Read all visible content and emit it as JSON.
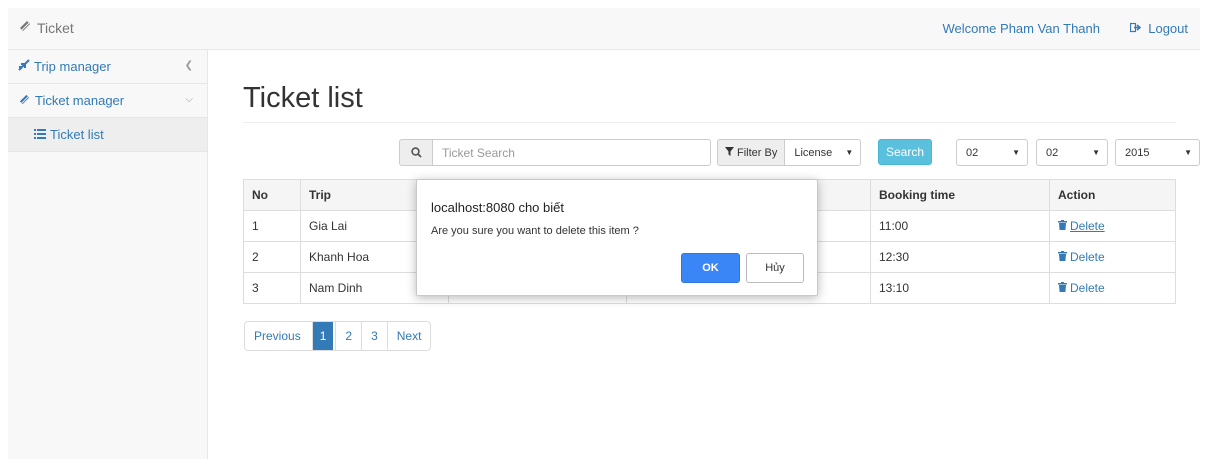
{
  "navbar": {
    "brand": "Ticket",
    "welcome": "Welcome Pham Van Thanh",
    "logout": "Logout"
  },
  "sidebar": {
    "items": [
      {
        "label": "Trip manager",
        "icon": "plane-icon"
      },
      {
        "label": "Ticket manager",
        "icon": "ticket-icon"
      }
    ],
    "sub_items": [
      {
        "label": "Ticket list",
        "icon": "list-icon"
      }
    ]
  },
  "main": {
    "title": "Ticket list"
  },
  "toolbar": {
    "search_placeholder": "Ticket Search",
    "filter_label": "Filter By",
    "filter_value": "License",
    "search_button": "Search",
    "day": "02",
    "month": "02",
    "year": "2015"
  },
  "table": {
    "headers": [
      "No",
      "Trip",
      "",
      "",
      "Booking time",
      "Action"
    ],
    "rows": [
      {
        "no": "1",
        "trip": "Gia Lai",
        "c3": "",
        "c4": "",
        "booking": "11:00",
        "action": "Delete"
      },
      {
        "no": "2",
        "trip": "Khanh Hoa",
        "c3": "",
        "c4": "",
        "booking": "12:30",
        "action": "Delete"
      },
      {
        "no": "3",
        "trip": "Nam Dinh",
        "c3": "",
        "c4": "",
        "booking": "13:10",
        "action": "Delete"
      }
    ]
  },
  "pagination": {
    "previous": "Previous",
    "pages": [
      "1",
      "2",
      "3"
    ],
    "active": "1",
    "next": "Next"
  },
  "dialog": {
    "title": "localhost:8080 cho biết",
    "message": "Are you sure you want to delete this item ?",
    "ok": "OK",
    "cancel": "Hủy"
  },
  "colors": {
    "link": "#337ab7",
    "info_button": "#5bc0de",
    "dialog_ok": "#3b86f7"
  }
}
